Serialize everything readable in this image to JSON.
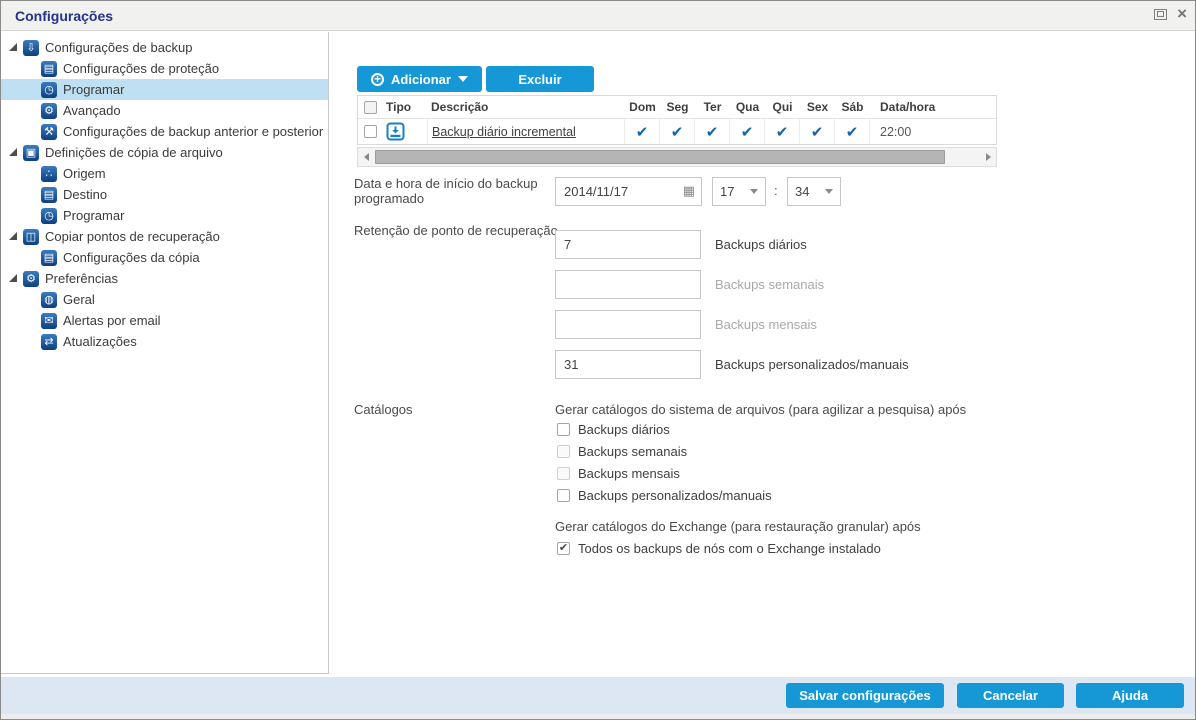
{
  "window": {
    "title": "Configurações"
  },
  "sidebar": {
    "items": [
      {
        "label": "Configurações de backup",
        "level": 0,
        "expanded": true,
        "icon": "backup-icon",
        "glyph": "⇩"
      },
      {
        "label": "Configurações de proteção",
        "level": 1,
        "icon": "protection-settings-icon",
        "glyph": "▤"
      },
      {
        "label": "Programar",
        "level": 1,
        "selected": true,
        "icon": "schedule-icon",
        "glyph": "◷"
      },
      {
        "label": "Avançado",
        "level": 1,
        "icon": "advanced-gears-icon",
        "glyph": "⚙"
      },
      {
        "label": "Configurações de backup anterior e posterior",
        "level": 1,
        "icon": "pre-post-wrench-icon",
        "glyph": "⚒"
      },
      {
        "label": "Definições de cópia de arquivo",
        "level": 0,
        "expanded": true,
        "icon": "file-copy-icon",
        "glyph": "▣"
      },
      {
        "label": "Origem",
        "level": 1,
        "icon": "source-icon",
        "glyph": "∴"
      },
      {
        "label": "Destino",
        "level": 1,
        "icon": "destination-icon",
        "glyph": "▤"
      },
      {
        "label": "Programar",
        "level": 1,
        "icon": "schedule-icon",
        "glyph": "◷"
      },
      {
        "label": "Copiar pontos de recuperação",
        "level": 0,
        "expanded": true,
        "icon": "copy-recovery-points-icon",
        "glyph": "◫"
      },
      {
        "label": "Configurações da cópia",
        "level": 1,
        "icon": "copy-settings-icon",
        "glyph": "▤"
      },
      {
        "label": "Preferências",
        "level": 0,
        "expanded": true,
        "icon": "preferences-gear-icon",
        "glyph": "⚙"
      },
      {
        "label": "Geral",
        "level": 1,
        "icon": "globe-icon",
        "glyph": "◍"
      },
      {
        "label": "Alertas por email",
        "level": 1,
        "icon": "email-icon",
        "glyph": "✉"
      },
      {
        "label": "Atualizações",
        "level": 1,
        "icon": "updates-icon",
        "glyph": "⇄"
      }
    ]
  },
  "toolbar": {
    "add_label": "Adicionar",
    "delete_label": "Excluir"
  },
  "schedule_table": {
    "columns": {
      "tipo": "Tipo",
      "descricao": "Descrição",
      "days": [
        "Dom",
        "Seg",
        "Ter",
        "Qua",
        "Qui",
        "Sex",
        "Sáb"
      ],
      "datahora": "Data/hora"
    },
    "rows": [
      {
        "descricao": "Backup diário incremental",
        "day_marks": [
          "✔",
          "✔",
          "✔",
          "✔",
          "✔",
          "✔",
          "✔"
        ],
        "time": "22:00"
      }
    ]
  },
  "start_datetime": {
    "label": "Data e hora de início do backup programado",
    "date": "2014/11/17",
    "hour": "17",
    "separator": ":",
    "minute": "34"
  },
  "retention": {
    "label": "Retenção de ponto de recuperação",
    "rows": [
      {
        "value": "7",
        "label": "Backups diários",
        "enabled": true
      },
      {
        "value": "",
        "label": "Backups semanais",
        "enabled": false
      },
      {
        "value": "",
        "label": "Backups mensais",
        "enabled": false
      },
      {
        "value": "31",
        "label": "Backups personalizados/manuais",
        "enabled": true
      }
    ]
  },
  "catalogs": {
    "label": "Catálogos",
    "filesystem_heading": "Gerar catálogos do sistema de arquivos (para agilizar a pesquisa) após",
    "filesystem_options": [
      {
        "label": "Backups diários",
        "checked": false,
        "enabled": true,
        "mark": ""
      },
      {
        "label": "Backups semanais",
        "checked": false,
        "enabled": false,
        "mark": ""
      },
      {
        "label": "Backups mensais",
        "checked": false,
        "enabled": false,
        "mark": ""
      },
      {
        "label": "Backups personalizados/manuais",
        "checked": false,
        "enabled": true,
        "mark": ""
      }
    ],
    "exchange_heading": "Gerar catálogos do Exchange (para restauração granular) após",
    "exchange_option": {
      "label": "Todos os backups de nós com o Exchange instalado",
      "checked": true,
      "mark": "✔"
    }
  },
  "footer": {
    "save_label": "Salvar configurações",
    "cancel_label": "Cancelar",
    "help_label": "Ajuda"
  },
  "colors": {
    "accent_button": "#1798d6",
    "selection": "#bfdff2",
    "day_check": "#1565a8",
    "footer_bg": "#dde7f3",
    "title_text": "#23338c"
  }
}
